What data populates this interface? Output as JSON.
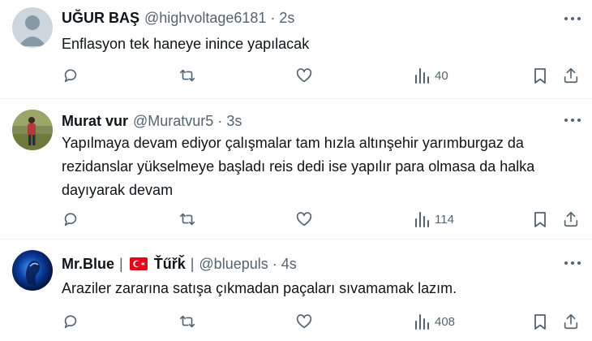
{
  "tweets": [
    {
      "name": "UĞUR BAŞ",
      "handle": "@highvoltage6181",
      "time": "2s",
      "text": "Enflasyon tek haneye inince yapılacak",
      "views": "40"
    },
    {
      "name": "Murat vur",
      "handle": "@Muratvur5",
      "time": "3s",
      "text": "Yapılmaya devam ediyor çalışmalar tam hızla altınşehir  yarımburgaz da rezidanslar yükselmeye başladı reis dedi ise yapılır para olmasa da halka dayıyarak devam",
      "views": "114"
    },
    {
      "name": "Mr.Blue",
      "name_separator": "|",
      "name_suffix": "Ťűřǩ",
      "handle_separator": "|",
      "handle": "@bluepuls",
      "time": "4s",
      "text": "Araziler zararına satışa çıkmadan paçaları sıvamamak lazım.",
      "views": "408"
    }
  ],
  "separator_dot": "·",
  "colors": {
    "text_primary": "#0f1419",
    "text_secondary": "#536471",
    "divider": "#eff3f4",
    "flag_red": "#e30a17"
  },
  "icons": [
    "reply-icon",
    "retweet-icon",
    "like-icon",
    "views-icon",
    "bookmark-icon",
    "share-icon",
    "more-icon"
  ]
}
